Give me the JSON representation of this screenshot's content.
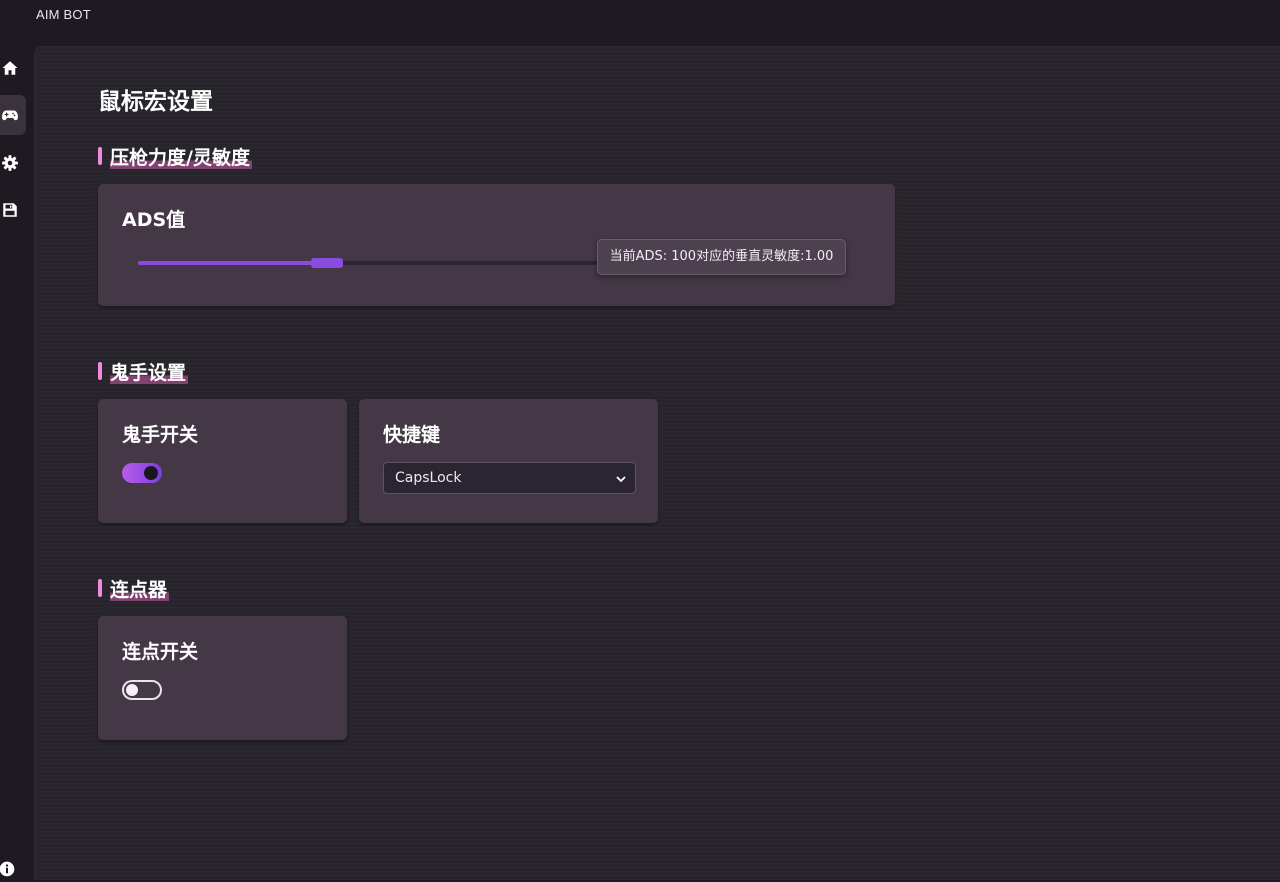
{
  "app": {
    "title": "AIM BOT"
  },
  "sidebar": {
    "items": [
      {
        "icon": "home-icon",
        "active": false
      },
      {
        "icon": "gamepad-icon",
        "active": true
      },
      {
        "icon": "gear-icon",
        "active": false
      },
      {
        "icon": "save-icon",
        "active": false
      }
    ],
    "footer_icon": "info-icon"
  },
  "page": {
    "title": "鼠标宏设置"
  },
  "sections": {
    "recoil": {
      "title": "压枪力度/灵敏度",
      "ads_card": {
        "label": "ADS值",
        "slider_fraction": 0.41,
        "tooltip": "当前ADS: 100对应的垂直灵敏度:1.00"
      }
    },
    "ghost": {
      "title": "鬼手设置",
      "switch_card": {
        "label": "鬼手开关",
        "enabled": true
      },
      "hotkey_card": {
        "label": "快捷键",
        "selected": "CapsLock"
      }
    },
    "clicker": {
      "title": "连点器",
      "switch_card": {
        "label": "连点开关",
        "enabled": false
      }
    }
  },
  "colors": {
    "accent": "#8a4ce0",
    "section_marker": "#f08ce0",
    "card_bg": "#443846",
    "app_bg": "#1f1a22"
  }
}
